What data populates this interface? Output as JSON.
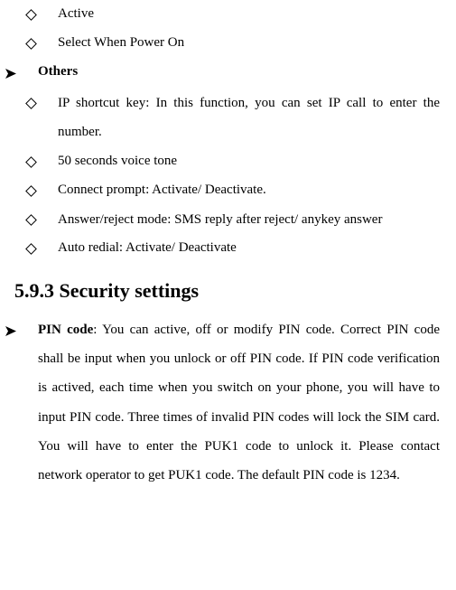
{
  "items_top": [
    "Active",
    "Select When Power On"
  ],
  "others_label": "Others",
  "others_items": [
    "IP shortcut key: In this function, you can set IP call to enter the number.",
    "50 seconds voice tone",
    "Connect prompt: Activate/ Deactivate.",
    "Answer/reject mode: SMS reply after reject/ anykey answer",
    "Auto redial: Activate/ Deactivate"
  ],
  "heading": "5.9.3  Security settings",
  "pin_section": {
    "lead": "PIN code",
    "rest": ": You can active, off or modify PIN code. Correct PIN code shall be input when you unlock or off PIN code. If PIN code verification is actived, each time when you switch on your phone, you will have to input PIN code. Three times of invalid PIN codes will lock the SIM card. You will have to enter the PUK1 code to unlock it. Please contact network operator to get PUK1 code. The default PIN code is 1234."
  }
}
